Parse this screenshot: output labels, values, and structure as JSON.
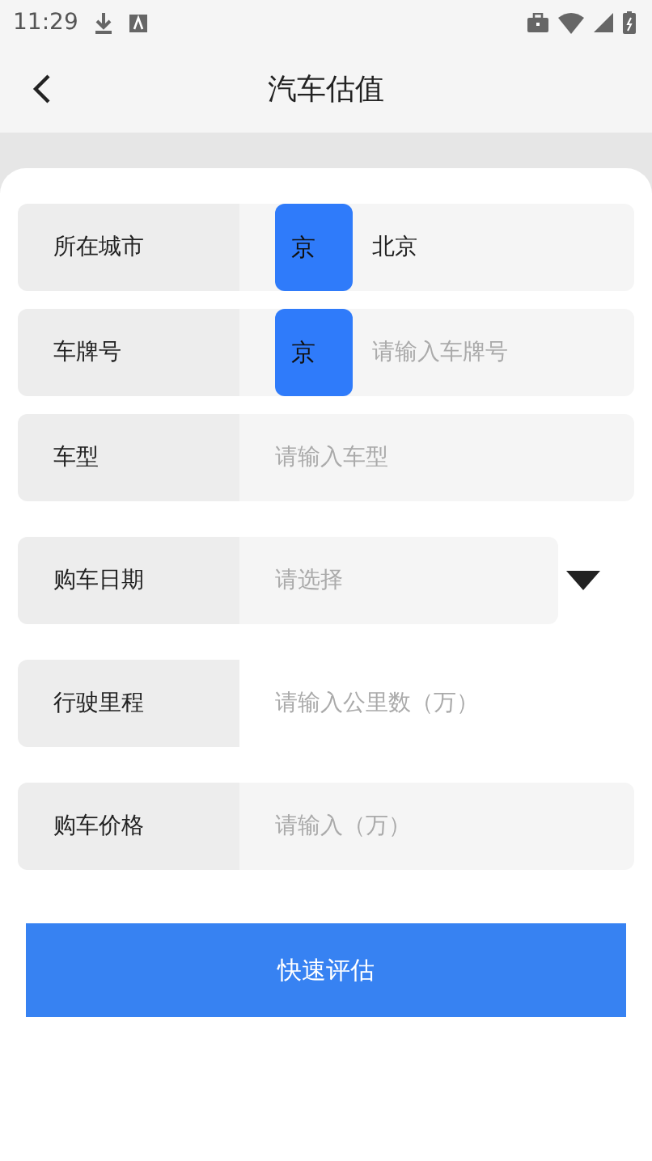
{
  "status_bar": {
    "time": "11:29"
  },
  "header": {
    "title": "汽车估值"
  },
  "form": {
    "rows": [
      {
        "kind": "prefix_input",
        "label": "所在城市",
        "prefix": "京",
        "value": "北京"
      },
      {
        "kind": "prefix_input",
        "label": "车牌号",
        "prefix": "京",
        "placeholder": "请输入车牌号"
      },
      {
        "kind": "input",
        "label": "车型",
        "placeholder": "请输入车型"
      },
      {
        "kind": "select",
        "label": "购车日期",
        "placeholder": "请选择"
      },
      {
        "kind": "bare_input",
        "label": "行驶里程",
        "placeholder": "请输入公里数（万）"
      },
      {
        "kind": "input",
        "label": "购车价格",
        "placeholder": "请输入（万）"
      }
    ]
  },
  "submit_button": {
    "label": "快速评估"
  }
}
